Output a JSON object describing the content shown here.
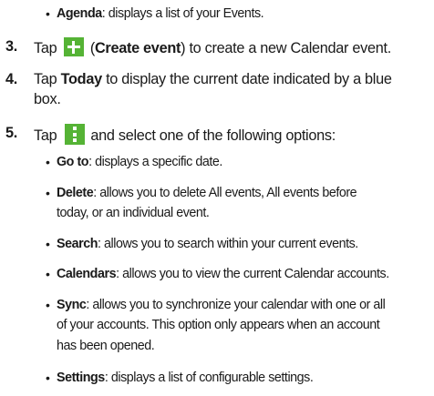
{
  "items": {
    "agenda": {
      "term": "Agenda",
      "desc": ": displays a list of your Events."
    },
    "step3": {
      "num": "3.",
      "pre": "Tap",
      "label": "Create event",
      "post": ") to create a new Calendar event."
    },
    "step4": {
      "num": "4.",
      "pre": "Tap",
      "today": "Today",
      "post": "to display the current date indicated by a blue",
      "cont": "box."
    },
    "step5": {
      "num": "5.",
      "pre": "Tap",
      "post": "and select one of the following options:"
    },
    "goto": {
      "term": "Go to",
      "desc": ": displays a specific date."
    },
    "delete": {
      "term": "Delete",
      "desc": ": allows you to delete All events, All events before",
      "cont": "today, or an individual event."
    },
    "search": {
      "term": "Search",
      "desc": ": allows you to search within your current events."
    },
    "calendars": {
      "term": "Calendars",
      "desc": ": allows you to view the current Calendar accounts."
    },
    "sync": {
      "term": "Sync",
      "desc": ": allows you to synchronize your calendar with one or all",
      "cont1": "of your accounts. This option only appears when an account",
      "cont2": "has been opened."
    },
    "settings": {
      "term": "Settings",
      "desc": ": displays a list of configurable settings."
    }
  },
  "icons": {
    "create": "plus-icon",
    "menu": "more-options-icon"
  },
  "colors": {
    "icon_green": "#55b335",
    "text": "#1a1a1a"
  }
}
